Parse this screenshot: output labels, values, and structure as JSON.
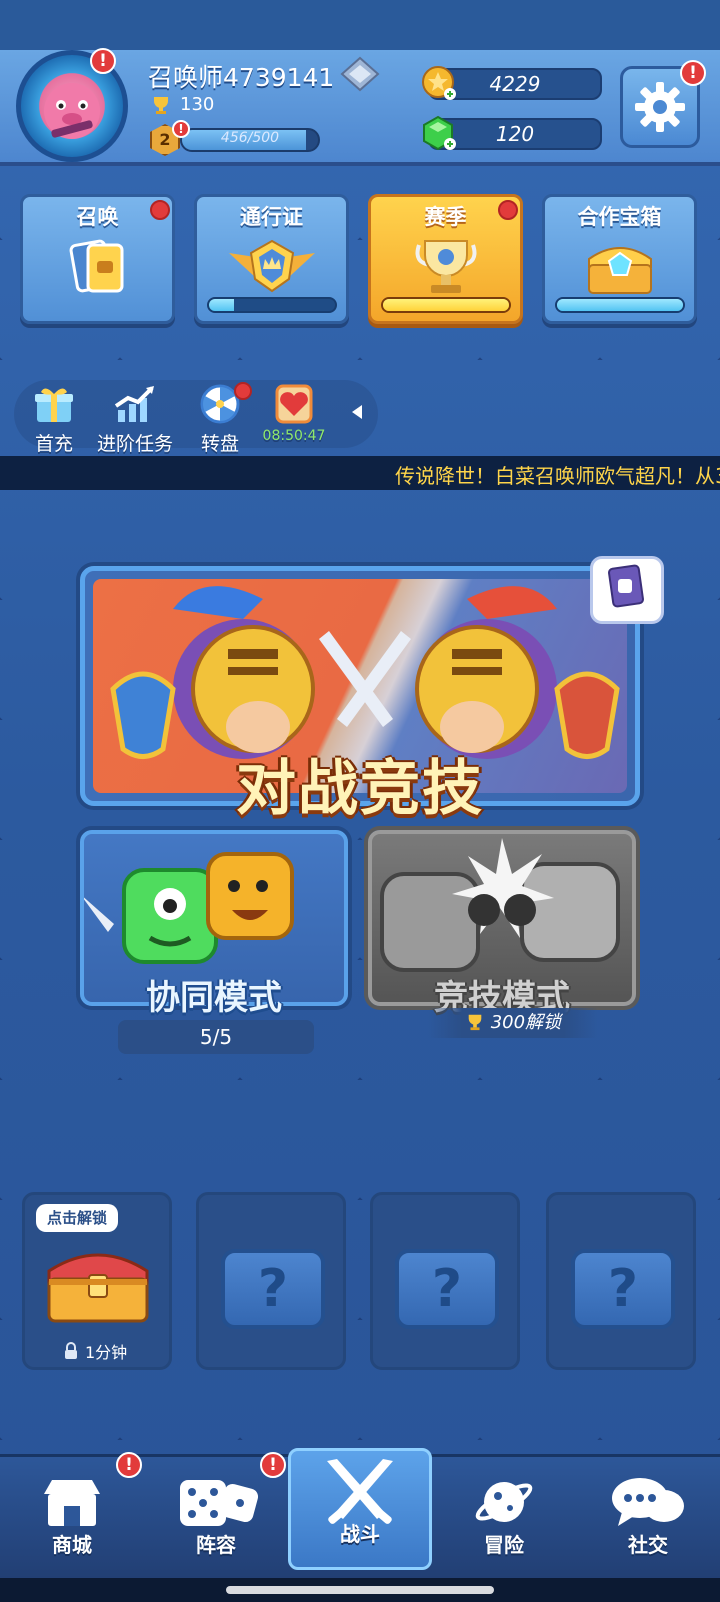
{
  "profile": {
    "name": "召唤师4739141",
    "trophies": "130",
    "level": "2",
    "xp_text": "456/500",
    "xp_progress": 0.912,
    "avatar_badge": "!",
    "level_badge": "!"
  },
  "currency": {
    "coins": "4229",
    "gems": "120"
  },
  "settings_badge": "!",
  "feature_cards": [
    {
      "label": "召唤",
      "progress": null
    },
    {
      "label": "通行证",
      "progress": 0.2
    },
    {
      "label": "赛季",
      "progress": 1.0
    },
    {
      "label": "合作宝箱",
      "progress": 1.0
    }
  ],
  "shortcuts": [
    {
      "label": "首充"
    },
    {
      "label": "进阶任务"
    },
    {
      "label": "转盘"
    },
    {
      "label": "08:50:47"
    }
  ],
  "ticker": "传说降世！白菜召唤师欧气超凡！从3",
  "battle": {
    "title": "对战竞技"
  },
  "modes": {
    "coop": {
      "title": "协同模式",
      "count": "5/5"
    },
    "competitive": {
      "title": "竞技模式",
      "unlock": "300解锁"
    }
  },
  "chests": {
    "first": {
      "bubble": "点击解锁",
      "timer": "1分钟"
    },
    "empty_label": "?"
  },
  "nav": [
    {
      "label": "商城",
      "badge": "!"
    },
    {
      "label": "阵容",
      "badge": "!"
    },
    {
      "label": "战斗",
      "badge": ""
    },
    {
      "label": "冒险",
      "badge": ""
    },
    {
      "label": "社交",
      "badge": ""
    }
  ],
  "colors": {
    "background": "#2f5ea4",
    "accent_gold": "#ffd34d",
    "badge_red": "#e23b3b",
    "ticker_text": "#ffd54a"
  }
}
